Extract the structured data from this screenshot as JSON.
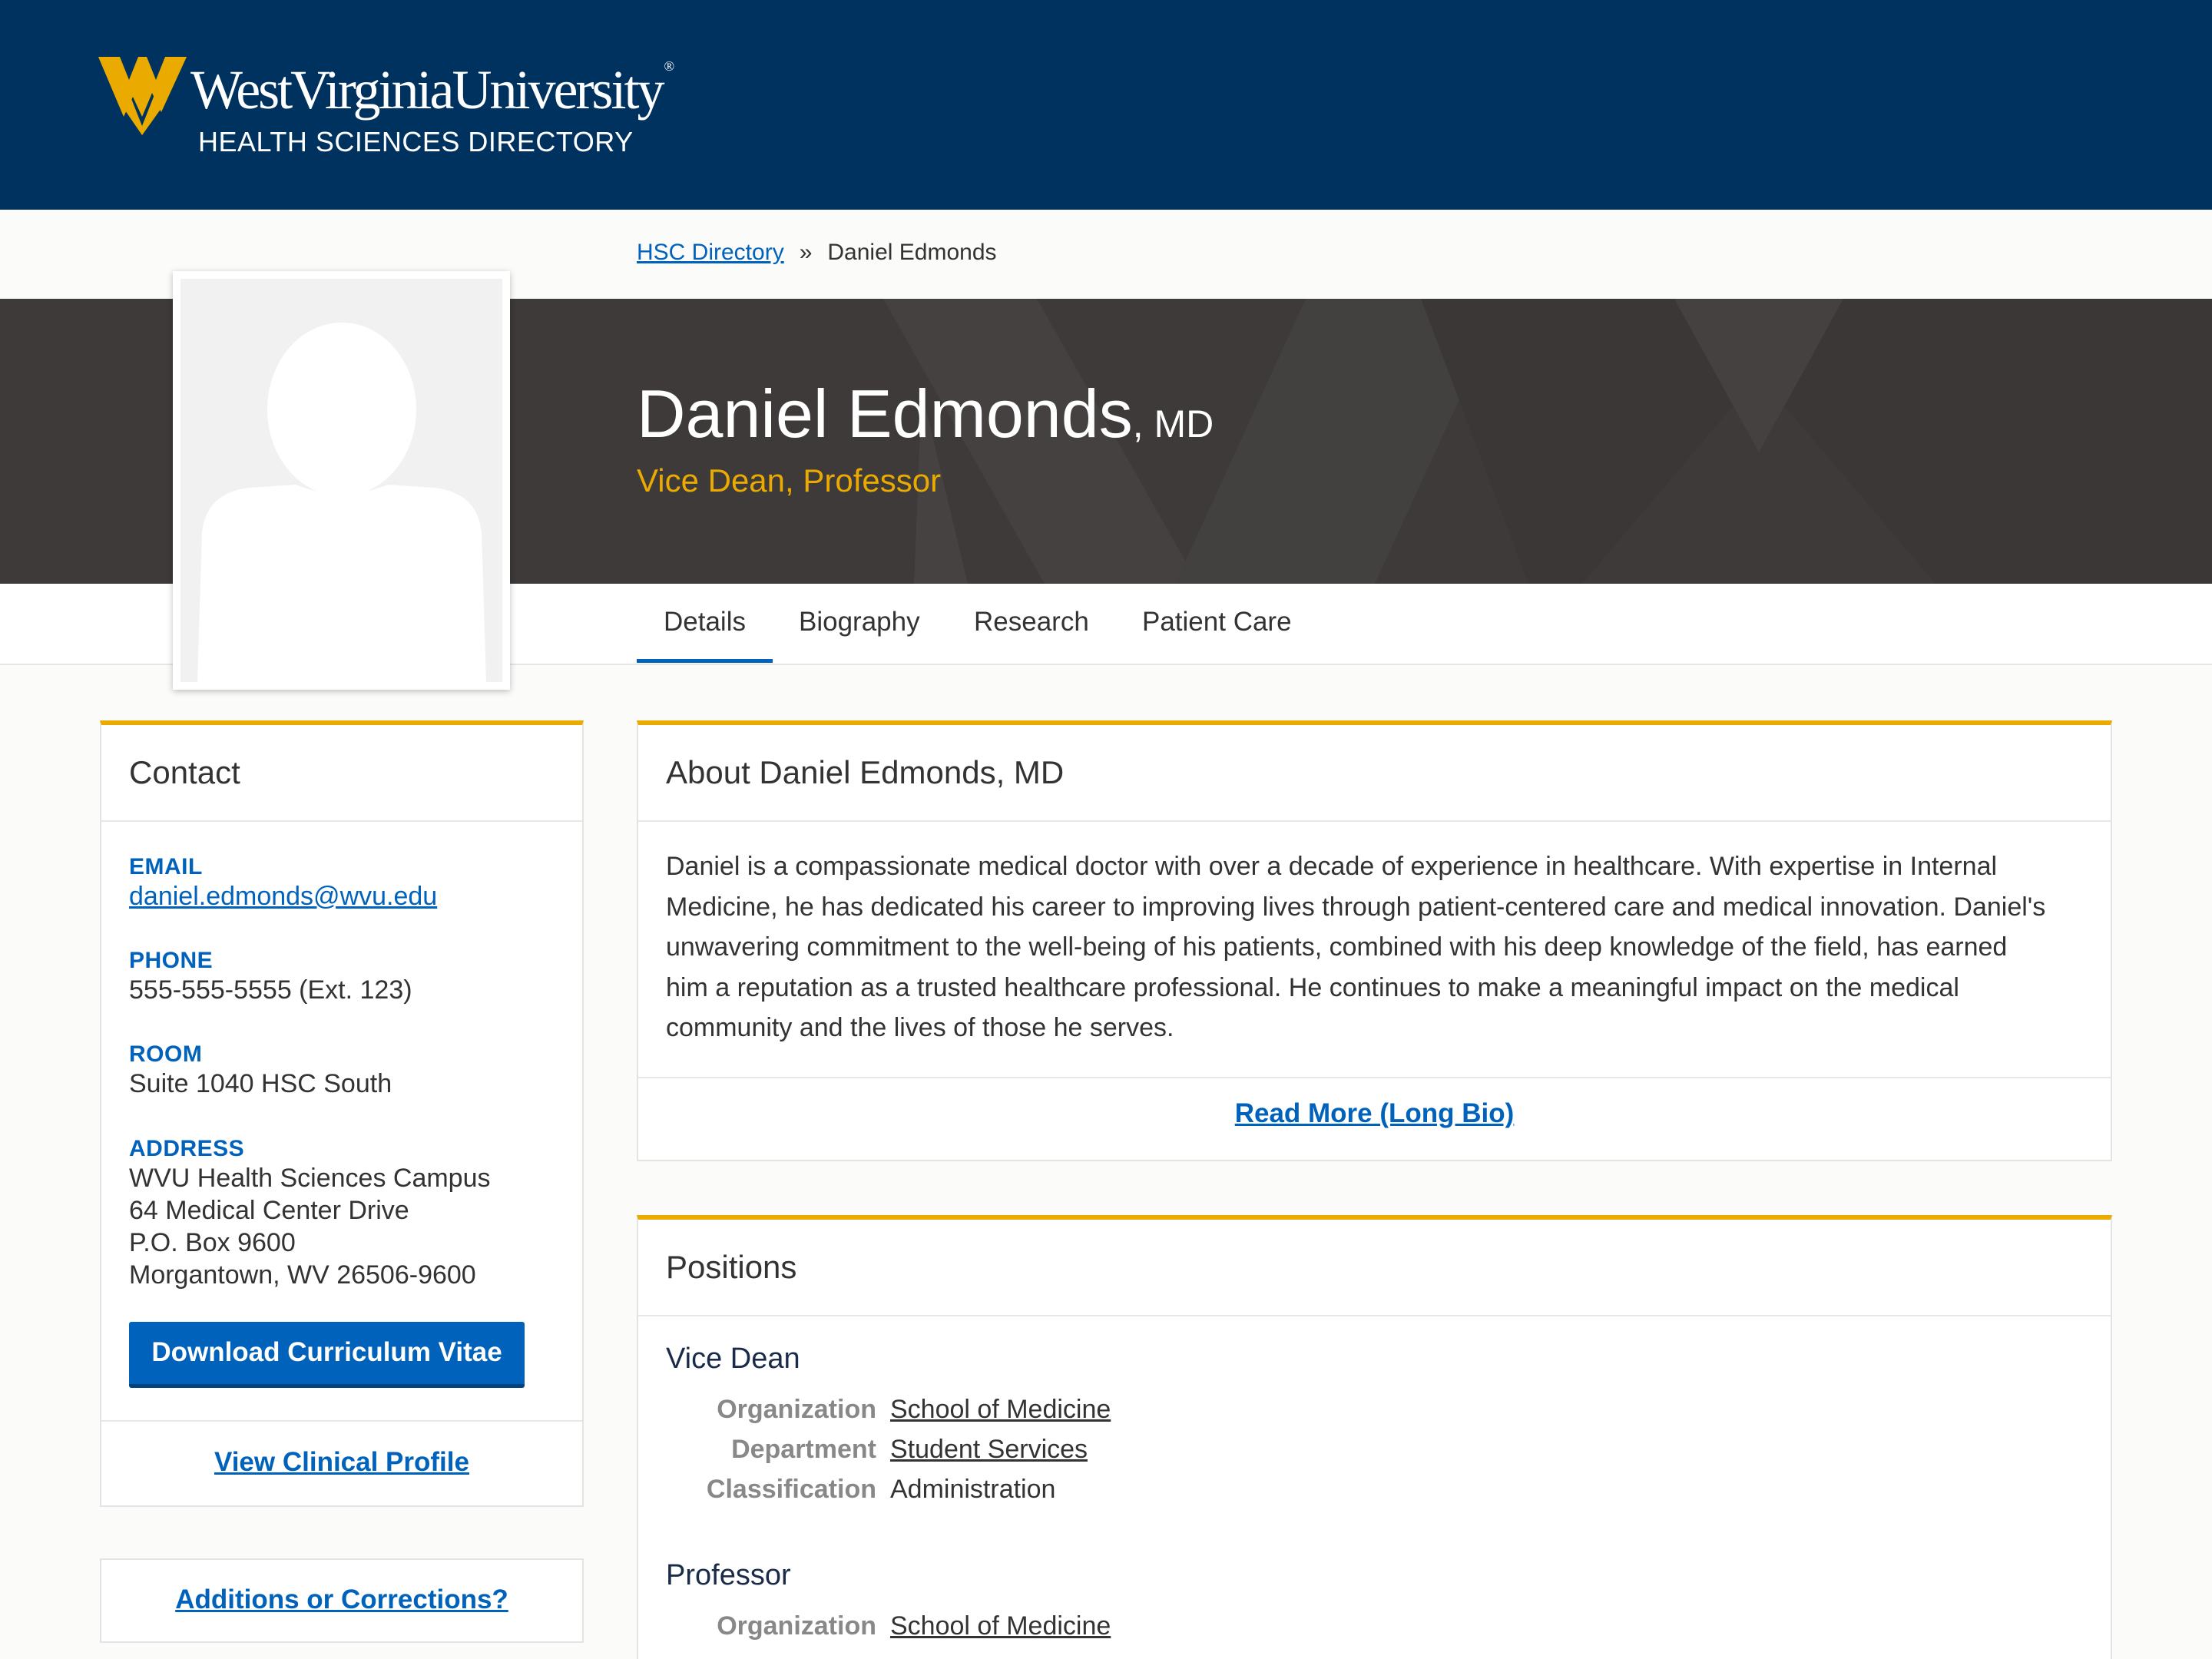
{
  "header": {
    "logo_wordmark": "WestVirginiaUniversity",
    "logo_reg": "®",
    "logo_subtitle": "HEALTH SCIENCES DIRECTORY"
  },
  "breadcrumb": {
    "home": "HSC Directory",
    "separator": "»",
    "current": "Daniel Edmonds"
  },
  "profile": {
    "name": "Daniel Edmonds",
    "credentials": ", MD",
    "title": "Vice Dean, Professor"
  },
  "tabs": [
    {
      "label": "Details",
      "active": true
    },
    {
      "label": "Biography"
    },
    {
      "label": "Research"
    },
    {
      "label": "Patient Care"
    }
  ],
  "contact": {
    "heading": "Contact",
    "email_label": "EMAIL",
    "email": "daniel.edmonds@wvu.edu",
    "phone_label": "PHONE",
    "phone": "555-555-5555 (Ext. 123)",
    "room_label": "ROOM",
    "room": "Suite 1040 HSC South",
    "address_label": "ADDRESS",
    "address_lines": [
      "WVU Health Sciences Campus",
      "64 Medical Center Drive",
      "P.O. Box 9600",
      "Morgantown, WV 26506-9600"
    ],
    "cv_button": "Download Curriculum Vitae",
    "clinical_link": "View Clinical Profile"
  },
  "corrections_link": "Additions or Corrections?",
  "about": {
    "heading": "About Daniel Edmonds, MD",
    "lines": [
      "Daniel is a compassionate medical doctor with over a decade of experience in healthcare. With expertise in Internal",
      "Medicine, he has dedicated his career to improving lives through patient-centered care and medical innovation. Daniel's",
      "unwavering commitment to the well-being of his patients, combined with his deep knowledge of the field, has earned",
      "him a reputation as a trusted healthcare professional. He continues to make a meaningful impact on the medical",
      "community and the lives of those he serves."
    ],
    "read_more": "Read More (Long Bio)"
  },
  "positions": {
    "heading": "Positions",
    "items": [
      {
        "title": "Vice Dean",
        "organization_label": "Organization",
        "organization": "School of Medicine",
        "department_label": "Department",
        "department": "Student Services",
        "classification_label": "Classification",
        "classification": "Administration"
      },
      {
        "title": "Professor",
        "organization_label": "Organization",
        "organization": "School of Medicine"
      }
    ]
  },
  "colors": {
    "header_bg": "#00325f",
    "hero_bg": "#3d3a39",
    "gold": "#eaaa00",
    "link_blue": "#0062ba"
  }
}
